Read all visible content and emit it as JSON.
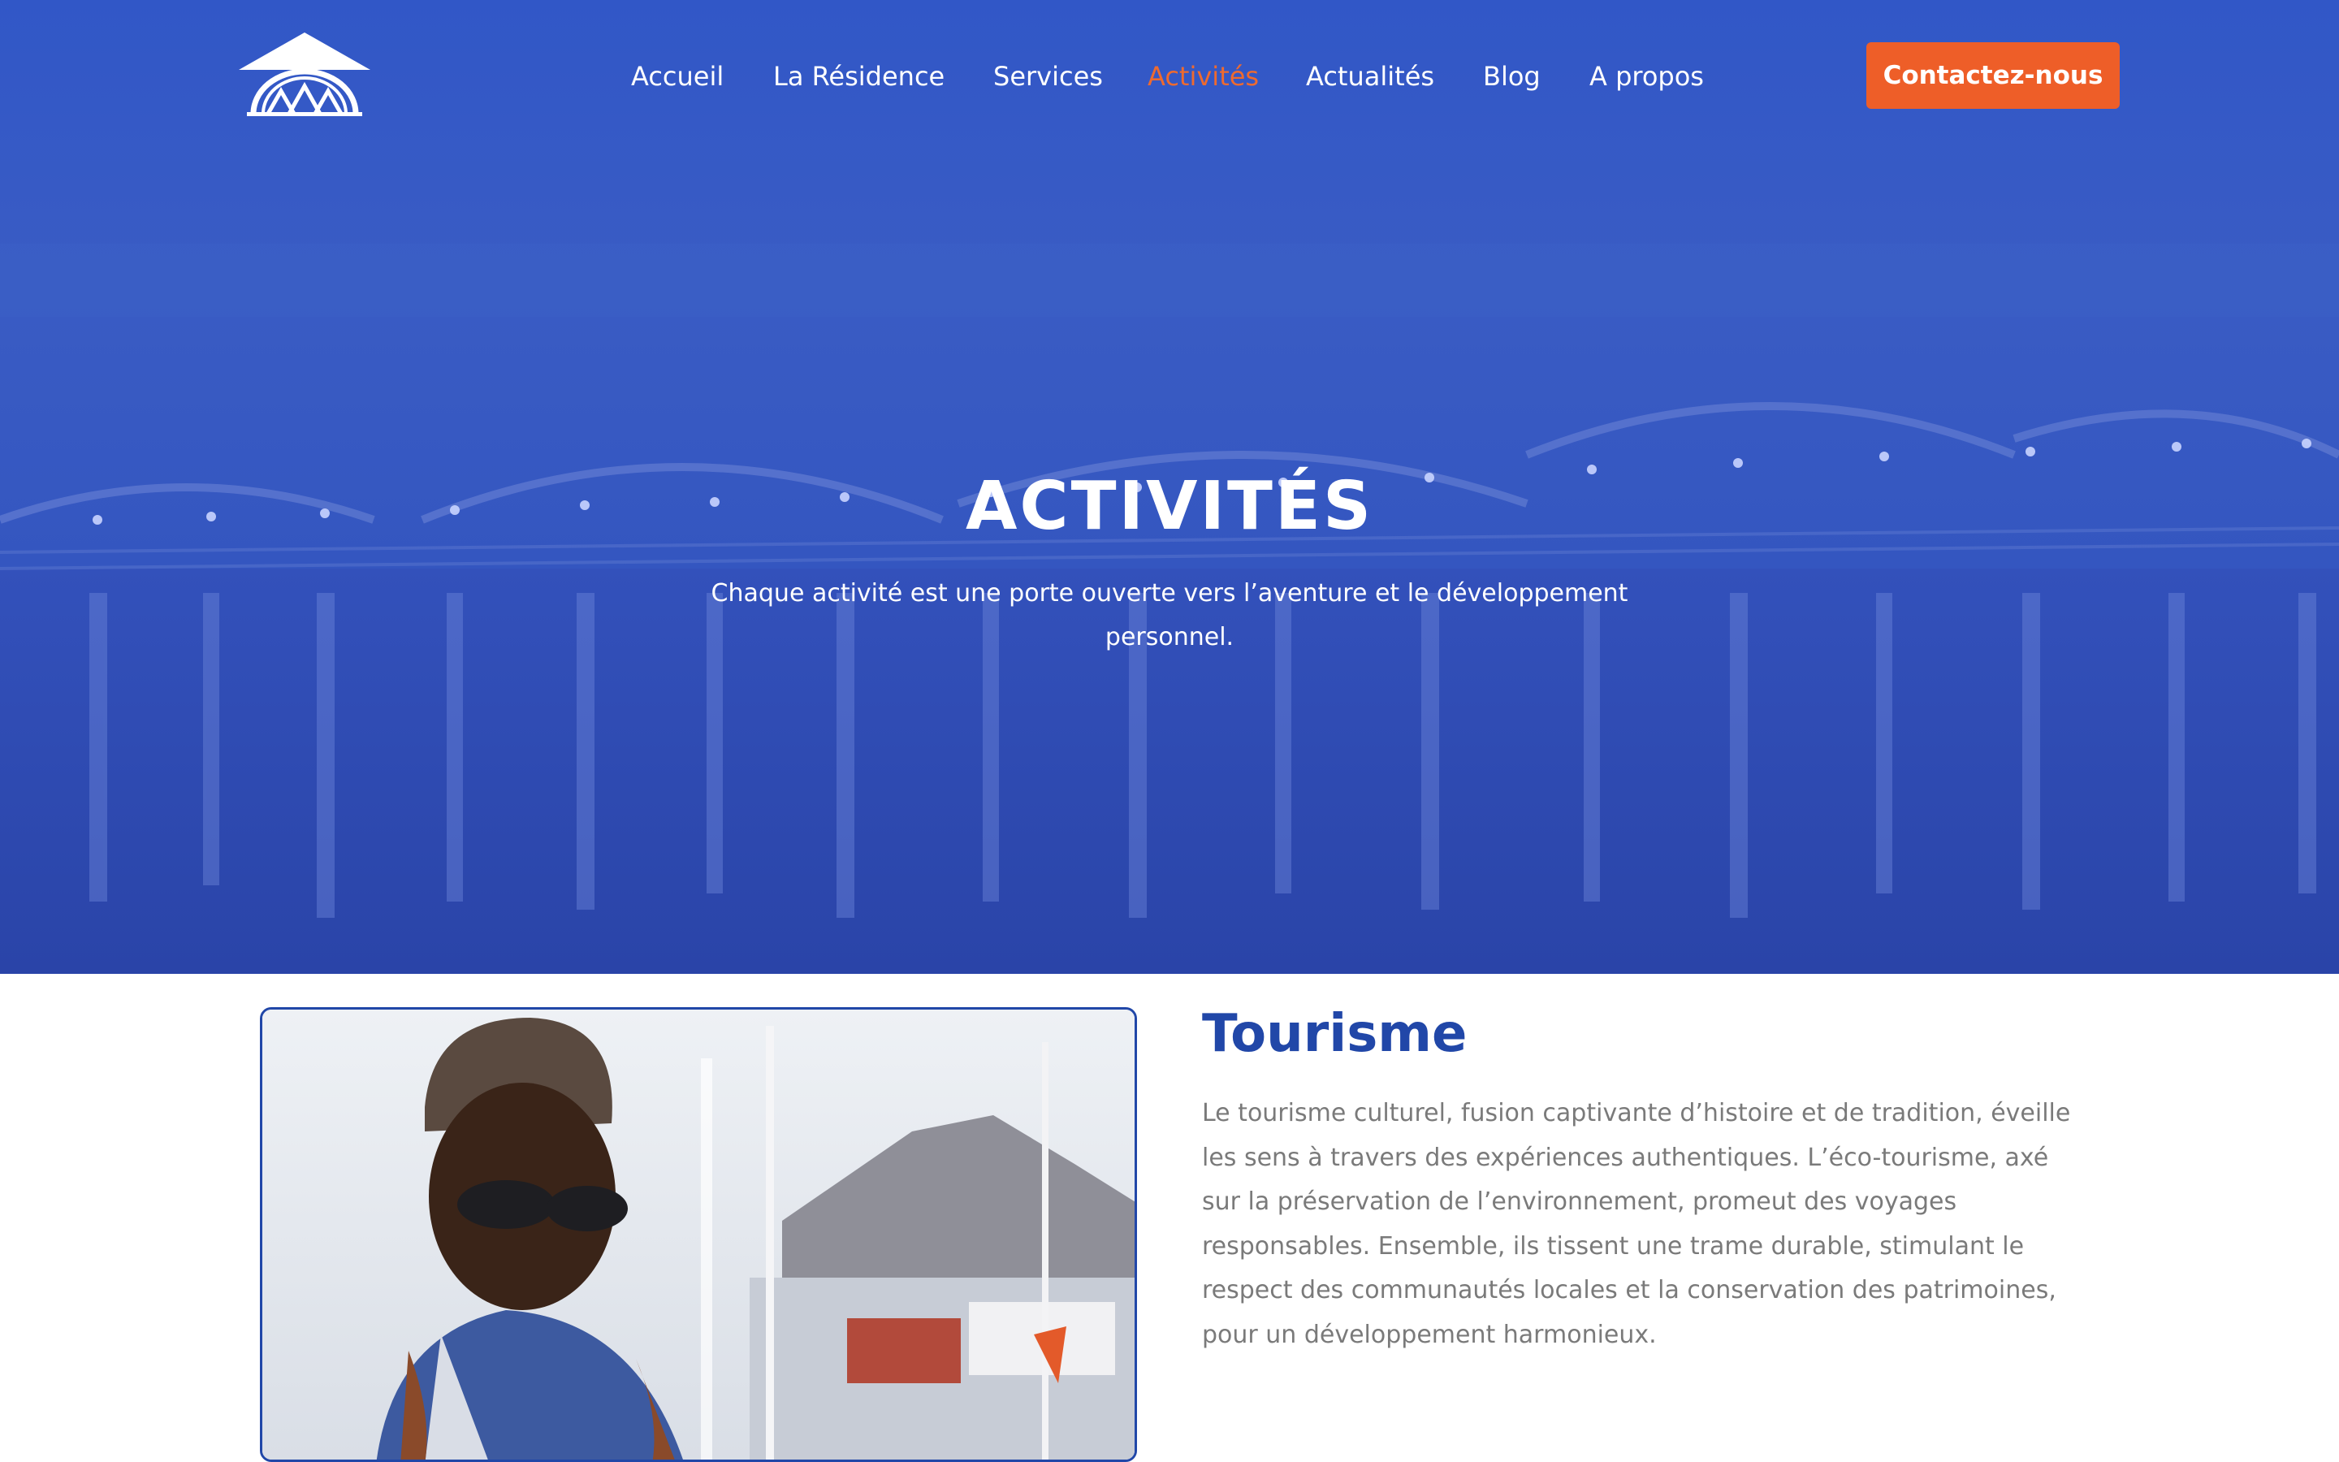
{
  "header": {
    "logo_icon": "residence-arch-logo",
    "nav": [
      {
        "label": "Accueil",
        "active": false
      },
      {
        "label": "La Résidence",
        "active": false
      },
      {
        "label": "Services",
        "active": false
      },
      {
        "label": "Activités",
        "active": true
      },
      {
        "label": "Actualités",
        "active": false
      },
      {
        "label": "Blog",
        "active": false
      },
      {
        "label": "A propos",
        "active": false
      }
    ],
    "cta_label": "Contactez-nous"
  },
  "hero": {
    "title": "ACTIVITÉS",
    "subtitle": "Chaque activité est une porte ouverte vers l’aventure et le développement personnel."
  },
  "section": {
    "title": "Tourisme",
    "text": "Le tourisme culturel, fusion captivante d’histoire et de tradition, éveille les sens à travers des expériences authentiques. L’éco-tourisme, axé sur la préservation de l’environnement, promeut des voyages responsables. Ensemble, ils tissent une trame durable, stimulant le respect des communautés locales et la conservation des patrimoines, pour un développement harmonieux."
  },
  "colors": {
    "hero_blue": "#3153bd",
    "accent_orange": "#ee5e28",
    "active_nav": "#ee6a2f",
    "heading_blue": "#2147a8",
    "body_text": "#7a7a7a"
  }
}
